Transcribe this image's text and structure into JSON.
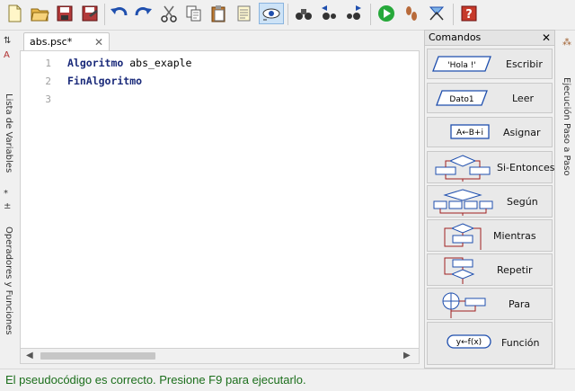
{
  "toolbar": {
    "buttons": [
      {
        "icon": "new-file-icon"
      },
      {
        "icon": "open-folder-icon"
      },
      {
        "icon": "save-icon"
      },
      {
        "icon": "save-as-icon"
      },
      {
        "icon": "undo-icon"
      },
      {
        "icon": "redo-icon"
      },
      {
        "icon": "cut-icon"
      },
      {
        "icon": "copy-icon"
      },
      {
        "icon": "paste-icon"
      },
      {
        "icon": "text-edit-icon"
      },
      {
        "icon": "watch-icon"
      },
      {
        "icon": "binoculars-icon"
      },
      {
        "icon": "find-prev-icon"
      },
      {
        "icon": "find-next-icon"
      },
      {
        "icon": "run-icon"
      },
      {
        "icon": "step-icon"
      },
      {
        "icon": "flowchart-icon"
      },
      {
        "icon": "help-icon"
      }
    ]
  },
  "left_panel": {
    "variables_label": "Lista de Variables",
    "operators_label": "Operadores y Funciones"
  },
  "editor": {
    "tab_label": "abs.psc*",
    "lines": [
      {
        "number": "1",
        "keyword": "Algoritmo",
        "rest": " abs_exaple"
      },
      {
        "number": "2",
        "keyword": "FinAlgoritmo",
        "rest": ""
      },
      {
        "number": "3",
        "keyword": "",
        "rest": ""
      }
    ]
  },
  "commands": {
    "title": "Comandos",
    "items": [
      {
        "label": "Escribir",
        "diagram_text": "'Hola !'"
      },
      {
        "label": "Leer",
        "diagram_text": "Dato1"
      },
      {
        "label": "Asignar",
        "diagram_text": "A←B+i"
      },
      {
        "label": "Si-Entonces",
        "diagram_text": ""
      },
      {
        "label": "Según",
        "diagram_text": ""
      },
      {
        "label": "Mientras",
        "diagram_text": ""
      },
      {
        "label": "Repetir",
        "diagram_text": ""
      },
      {
        "label": "Para",
        "diagram_text": ""
      },
      {
        "label": "Función",
        "diagram_text": "y←f(x)"
      }
    ]
  },
  "right_panel": {
    "label": "Ejecución Paso a Paso"
  },
  "status": {
    "text": "El pseudocódigo es correcto. Presione F9 para ejecutarlo."
  }
}
